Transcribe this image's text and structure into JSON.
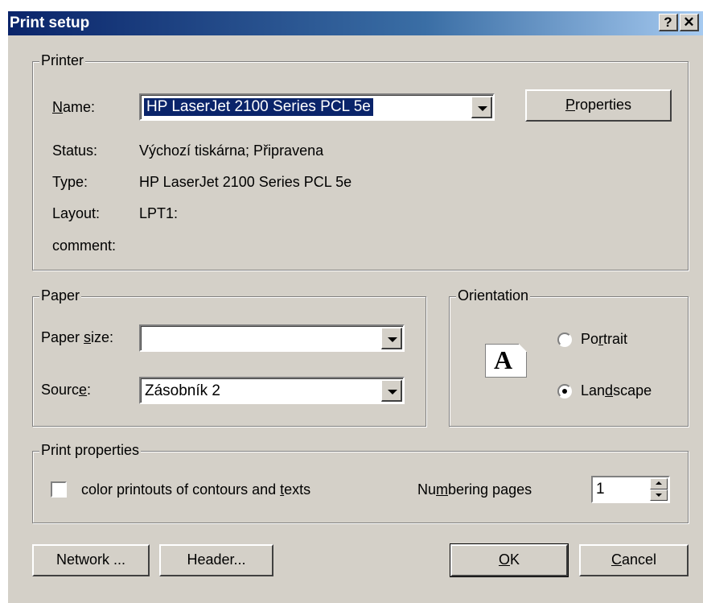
{
  "window": {
    "title": "Print setup",
    "help_label": "?",
    "close_label": "✕"
  },
  "printer": {
    "legend": "Printer",
    "name_label_pre": "",
    "name_label_u": "N",
    "name_label_post": "ame:",
    "name_value": "HP LaserJet 2100 Series PCL 5e",
    "properties_u": "P",
    "properties_rest": "roperties",
    "status_label": "Status:",
    "status_value": "Výchozí tiskárna; Připravena",
    "type_label": "Type:",
    "type_value": "HP LaserJet 2100 Series PCL 5e",
    "layout_label": "Layout:",
    "layout_value": "LPT1:",
    "comment_label": "comment:"
  },
  "paper": {
    "legend": "Paper",
    "size_label_pre": "Paper ",
    "size_label_u": "s",
    "size_label_post": "ize:",
    "size_value": "",
    "source_label_pre": "Sourc",
    "source_label_u": "e",
    "source_label_post": ":",
    "source_value": "Zásobník 2"
  },
  "orientation": {
    "legend": "Orientation",
    "icon_letter": "A",
    "portrait_pre": "Po",
    "portrait_u": "r",
    "portrait_post": "trait",
    "landscape_pre": "Lan",
    "landscape_u": "d",
    "landscape_post": "scape",
    "selected": "landscape"
  },
  "print_properties": {
    "legend": "Print properties",
    "color_label_pre": "color printouts of contours and ",
    "color_label_u": "t",
    "color_label_post": "exts",
    "color_checked": false,
    "numbering_pre": "Nu",
    "numbering_u": "m",
    "numbering_post": "bering pages",
    "numbering_value": "1"
  },
  "buttons": {
    "network": "Network ...",
    "header": "Header...",
    "ok_u": "O",
    "ok_rest": "K",
    "cancel_u": "C",
    "cancel_rest": "ancel"
  }
}
